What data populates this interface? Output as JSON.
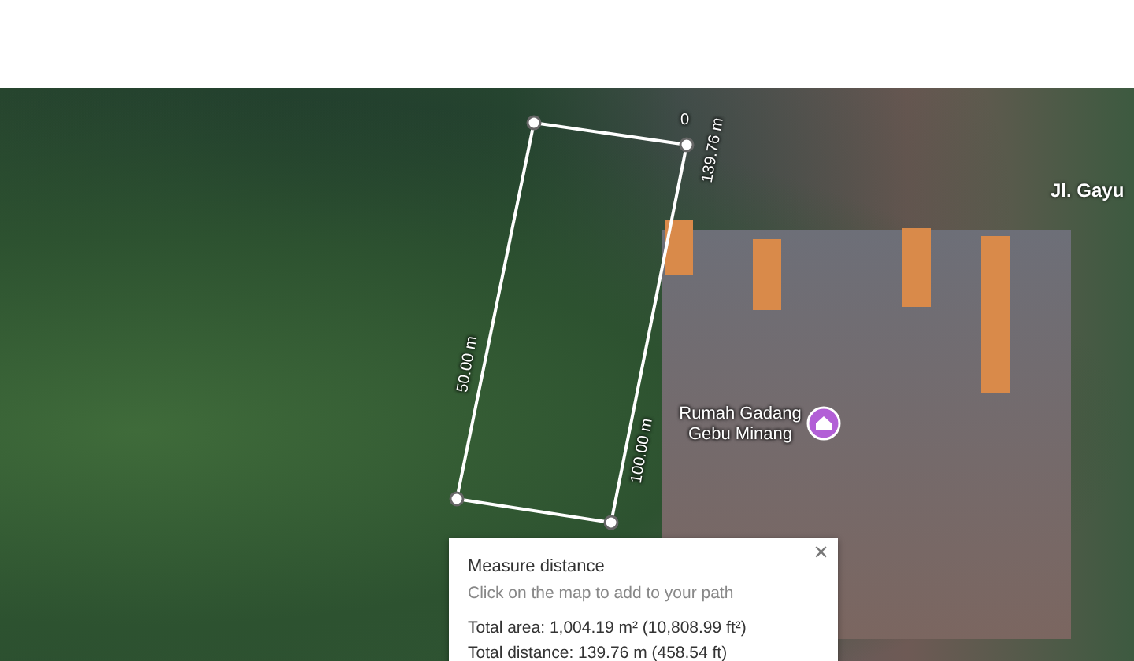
{
  "map": {
    "edge_labels": [
      {
        "kind": "vertex",
        "text": "0"
      },
      {
        "kind": "east",
        "text": "139.76 m"
      },
      {
        "kind": "west",
        "text": "50.00 m"
      },
      {
        "kind": "south",
        "text": "100.00 m"
      }
    ],
    "road_label": "Jl. Gayu",
    "place": {
      "name": "Rumah Gadang Gebu Minang"
    }
  },
  "measure_panel": {
    "title": "Measure distance",
    "hint": "Click on the map to add to your path",
    "close": "×",
    "lines": [
      "Total area: 1,004.19 m² (10,808.99 ft²)",
      "Total distance: 139.76 m (458.54 ft)"
    ]
  }
}
